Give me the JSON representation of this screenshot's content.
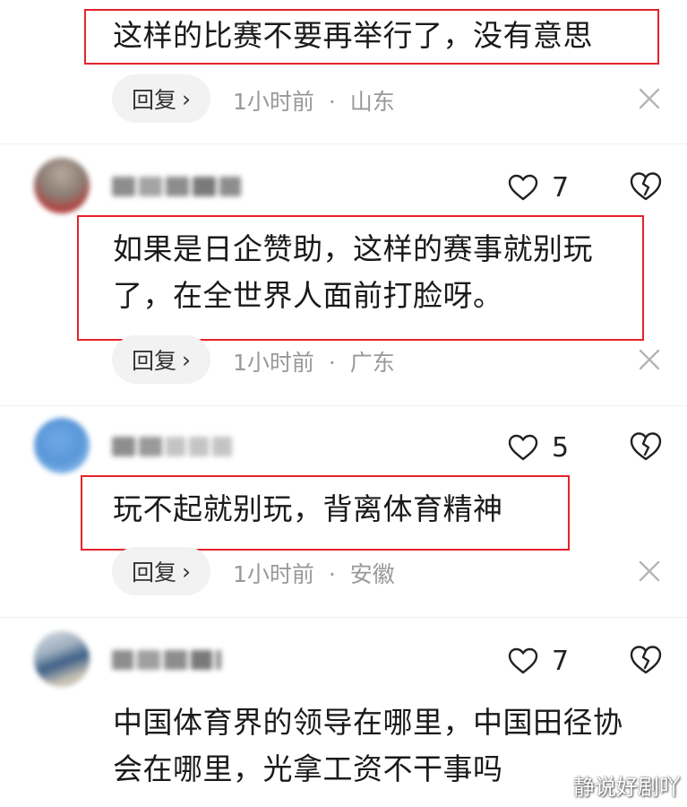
{
  "comments": [
    {
      "text_lines": [
        "这样的比赛不要再举行了，没有意思"
      ],
      "reply_label": "回复",
      "time": "1小时前",
      "location": "山东",
      "highlighted": true
    },
    {
      "text_lines": [
        "如果是日企赞助，这样的赛事就别玩",
        "了，在全世界人面前打脸呀。"
      ],
      "likes": "7",
      "reply_label": "回复",
      "time": "1小时前",
      "location": "广东",
      "highlighted": true
    },
    {
      "text_lines": [
        "玩不起就别玩，背离体育精神"
      ],
      "likes": "5",
      "reply_label": "回复",
      "time": "1小时前",
      "location": "安徽",
      "highlighted": true
    },
    {
      "text_lines": [
        "中国体育界的领导在哪里，中国田径协",
        "会在哪里，光拿工资不干事吗"
      ],
      "likes": "7",
      "highlighted": false
    }
  ],
  "dot_separator": "·",
  "reply_chevron": "›",
  "watermark": "静说好剧吖",
  "colors": {
    "highlight_border": "#e5232b",
    "meta_text": "#999999",
    "reply_bg": "#f2f2f2"
  },
  "icons": {
    "like": "heart-outline-icon",
    "dislike": "broken-heart-icon",
    "close": "close-icon",
    "reply": "chevron-right-icon"
  }
}
